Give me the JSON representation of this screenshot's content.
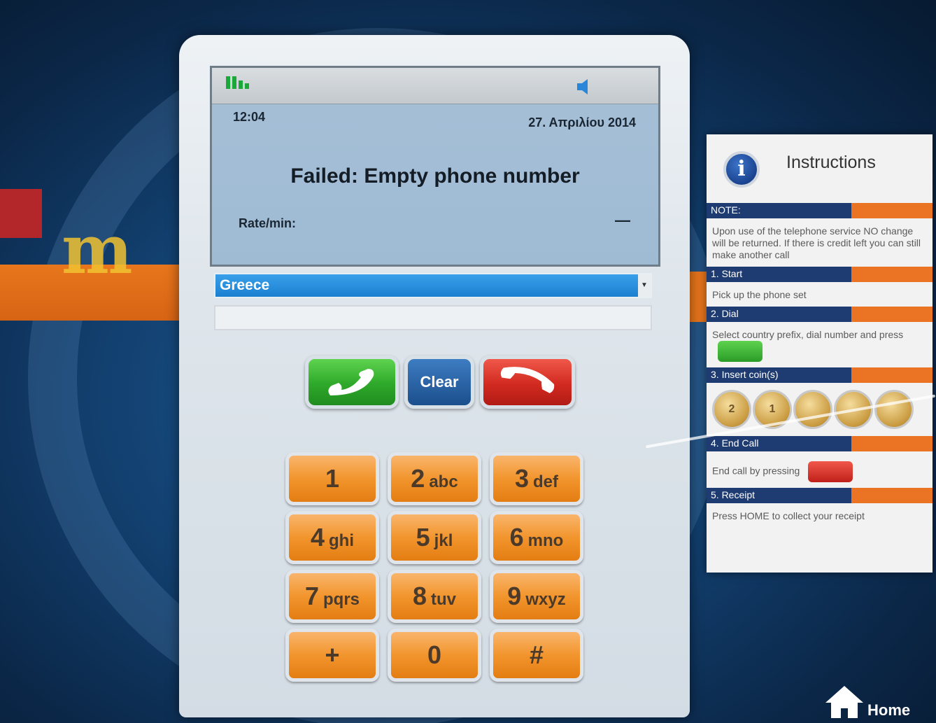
{
  "status_bar": {
    "time": "12:04",
    "date": "27. Απριλίου 2014"
  },
  "display": {
    "message": "Failed: Empty phone number",
    "rate_label": "Rate/min:",
    "rate_value": "—"
  },
  "dialer": {
    "country": "Greece",
    "number": "",
    "clear_label": "Clear"
  },
  "keypad": [
    {
      "digit": "1",
      "letters": ""
    },
    {
      "digit": "2",
      "letters": "abc"
    },
    {
      "digit": "3",
      "letters": "def"
    },
    {
      "digit": "4",
      "letters": "ghi"
    },
    {
      "digit": "5",
      "letters": "jkl"
    },
    {
      "digit": "6",
      "letters": "mno"
    },
    {
      "digit": "7",
      "letters": "pqrs"
    },
    {
      "digit": "8",
      "letters": "tuv"
    },
    {
      "digit": "9",
      "letters": "wxyz"
    },
    {
      "digit": "+",
      "letters": ""
    },
    {
      "digit": "0",
      "letters": ""
    },
    {
      "digit": "#",
      "letters": ""
    }
  ],
  "instructions": {
    "title": "Instructions",
    "note_title": "NOTE:",
    "note_text": "Upon use of the telephone service NO change will be returned. If there is credit left you can still make another call",
    "steps": [
      {
        "title": "1. Start",
        "text": "Pick up the phone set"
      },
      {
        "title": "2. Dial",
        "text": "Select country prefix, dial number and press"
      },
      {
        "title": "3. Insert coin(s)",
        "text": ""
      },
      {
        "title": "4. End Call",
        "text": "End call by pressing"
      },
      {
        "title": "5. Receipt",
        "text": "Press HOME to collect your receipt"
      }
    ],
    "coins": [
      "2",
      "1",
      "",
      "",
      ""
    ]
  },
  "home_label": "Home",
  "colors": {
    "call_green": "#2ea82a",
    "hangup_red": "#d22a20",
    "key_orange": "#f2952d",
    "clear_blue": "#1b4f8d",
    "select_blue": "#1b7fd0",
    "instr_navy": "#1f3c72",
    "instr_orange": "#ea7423"
  },
  "icons": {
    "signal": "signal-bars-icon",
    "speaker": "speaker-icon",
    "call": "phone-handset-icon",
    "hangup": "hang-up-icon",
    "info": "info-icon",
    "home": "home-icon"
  }
}
